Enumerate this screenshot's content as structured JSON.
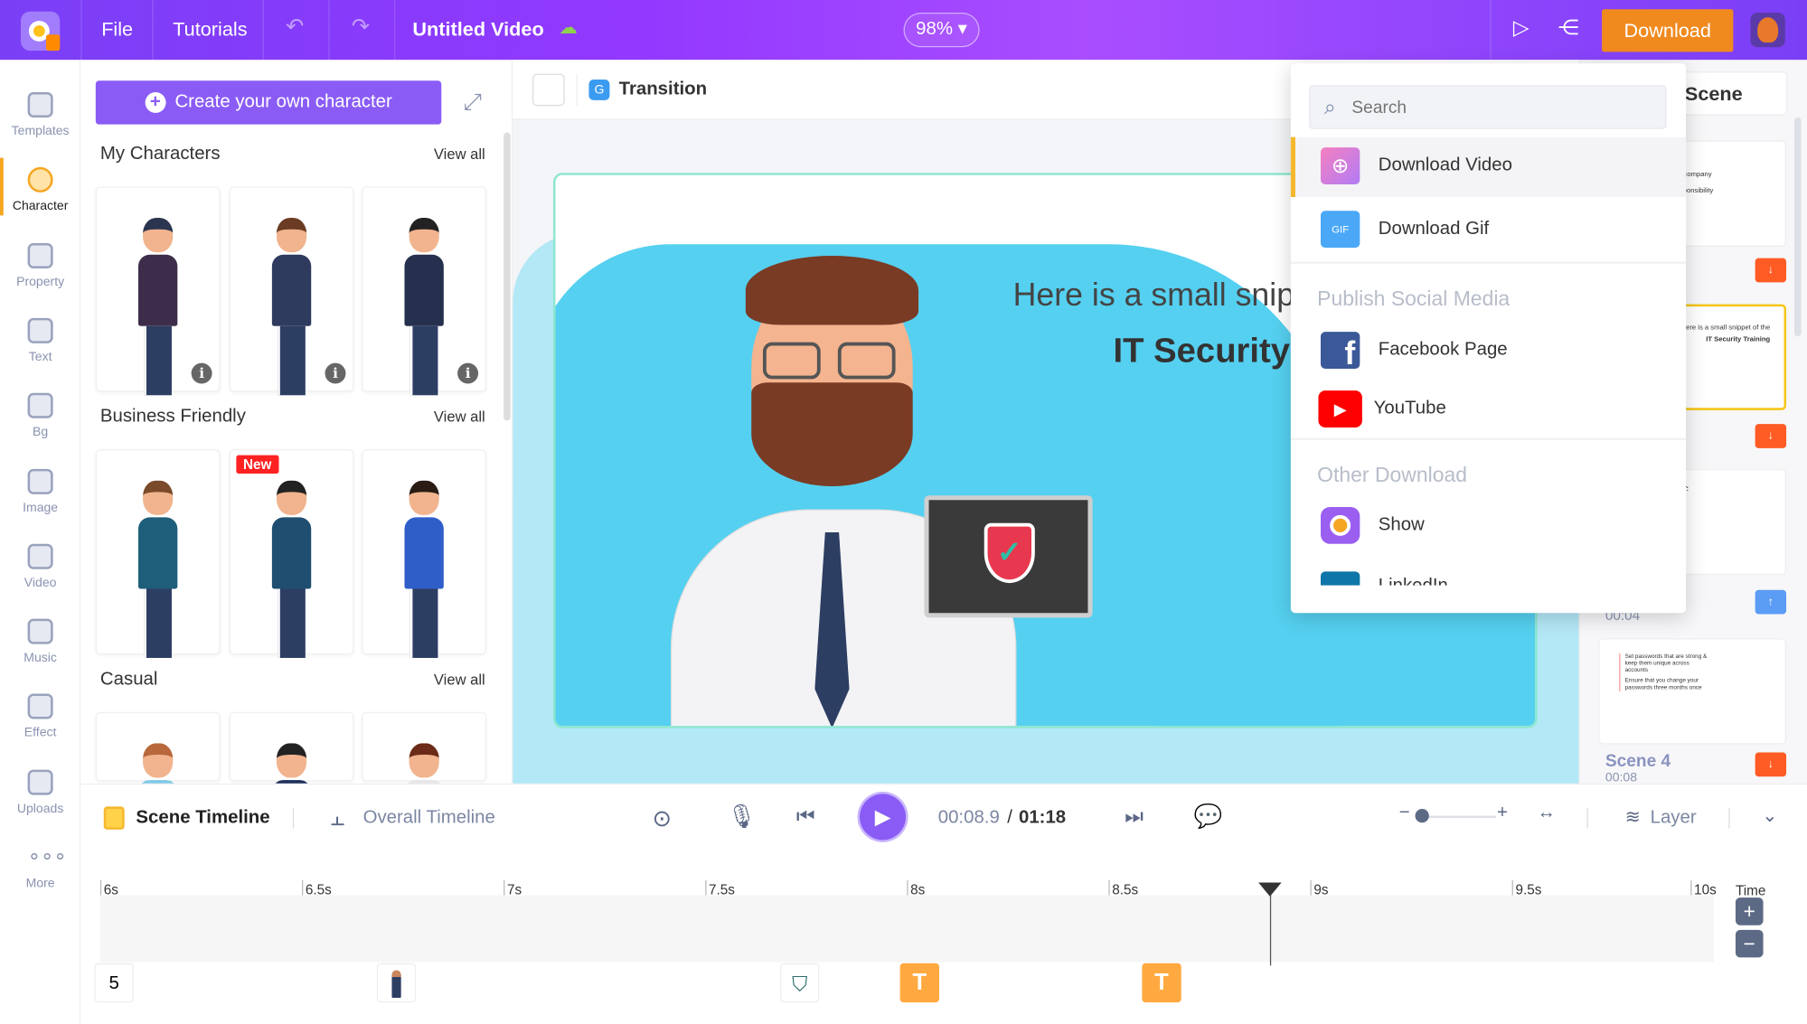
{
  "topbar": {
    "file": "File",
    "tutorials": "Tutorials",
    "title": "Untitled Video",
    "zoom": "98%",
    "download": "Download"
  },
  "rail": [
    {
      "label": "Templates",
      "icon": "templates-icon"
    },
    {
      "label": "Character",
      "icon": "character-icon",
      "active": true
    },
    {
      "label": "Property",
      "icon": "property-icon"
    },
    {
      "label": "Text",
      "icon": "text-icon"
    },
    {
      "label": "Bg",
      "icon": "background-icon"
    },
    {
      "label": "Image",
      "icon": "image-icon"
    },
    {
      "label": "Video",
      "icon": "video-icon"
    },
    {
      "label": "Music",
      "icon": "music-icon"
    },
    {
      "label": "Effect",
      "icon": "effect-icon"
    },
    {
      "label": "Uploads",
      "icon": "uploads-icon"
    },
    {
      "label": "More",
      "icon": "more-icon"
    }
  ],
  "panel": {
    "create": "Create your own character",
    "sections": [
      {
        "title": "My Characters",
        "view_all": "View all"
      },
      {
        "title": "Business Friendly",
        "view_all": "View all",
        "badge": "New"
      },
      {
        "title": "Casual",
        "view_all": "View all"
      }
    ]
  },
  "canvas": {
    "transition": "Transition",
    "scene_line1": "Here is a small snip",
    "scene_line2": "IT Security"
  },
  "scenes": {
    "add_scene": "Scene",
    "thumb1_lines": [
      "ur company",
      "esponsibility"
    ],
    "thumb2_lines": [
      "Here is a small snippet of the",
      "IT Security Training"
    ],
    "thumb3_text": "NT:",
    "time3": "00:04",
    "thumb4_lines": [
      "Set passwords that are strong & keep them unique across accounts",
      "Ensure that you change your passwords three months once"
    ],
    "scene4": "Scene 4",
    "time4": "00:08"
  },
  "dropdown": {
    "search_placeholder": "Search",
    "download_video": "Download Video",
    "download_gif": "Download Gif",
    "gif_icon_text": "GIF",
    "social_heading": "Publish Social Media",
    "facebook": "Facebook Page",
    "youtube": "YouTube",
    "other_heading": "Other Download",
    "show": "Show",
    "linkedin": "LinkedIn"
  },
  "timeline": {
    "scene_timeline": "Scene Timeline",
    "overall_timeline": "Overall Timeline",
    "current": "00:08.9",
    "separator": "/",
    "total": "01:18",
    "layer": "Layer",
    "time_label": "Time",
    "ticks": [
      "6s",
      "6.5s",
      "7s",
      "7.5s",
      "8s",
      "8.5s",
      "9s",
      "9.5s",
      "10s"
    ],
    "playhead_seconds": 8.9,
    "scene_number": "5"
  },
  "colors": {
    "accent": "#8a5cf5",
    "download": "#f08a1f",
    "active": "#f5a623",
    "text_clip": "#ffa940"
  }
}
